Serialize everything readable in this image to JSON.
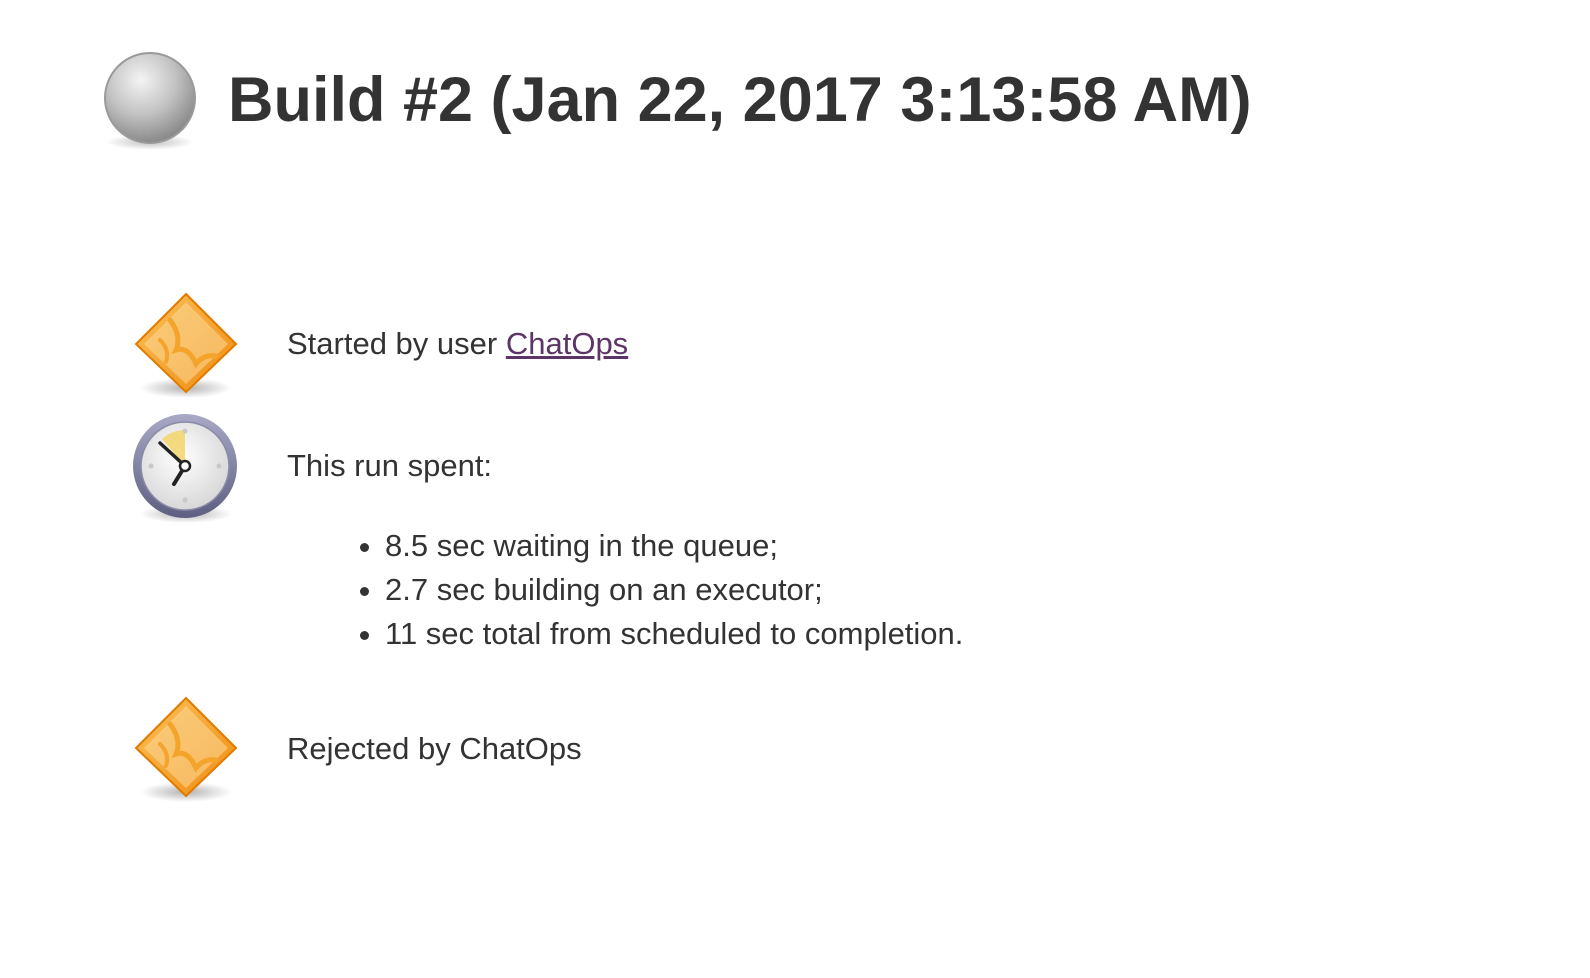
{
  "header": {
    "title": "Build #2 (Jan 22, 2017 3:13:58 AM)",
    "status_icon": "grey-ball-icon"
  },
  "causes": {
    "started": {
      "icon": "user-cause-icon",
      "prefix": "Started by user ",
      "user_link": "ChatOps"
    },
    "timing": {
      "icon": "clock-icon",
      "heading": "This run spent:",
      "items": [
        "8.5 sec waiting in the queue;",
        "2.7 sec building on an executor;",
        "11 sec total from scheduled to completion."
      ]
    },
    "rejected": {
      "icon": "user-cause-icon",
      "text": "Rejected by ChatOps"
    }
  },
  "colors": {
    "text": "#333333",
    "link_visited": "#5c3566",
    "orange_icon": "#f5a623",
    "grey_ball": "#b0b0b0"
  }
}
